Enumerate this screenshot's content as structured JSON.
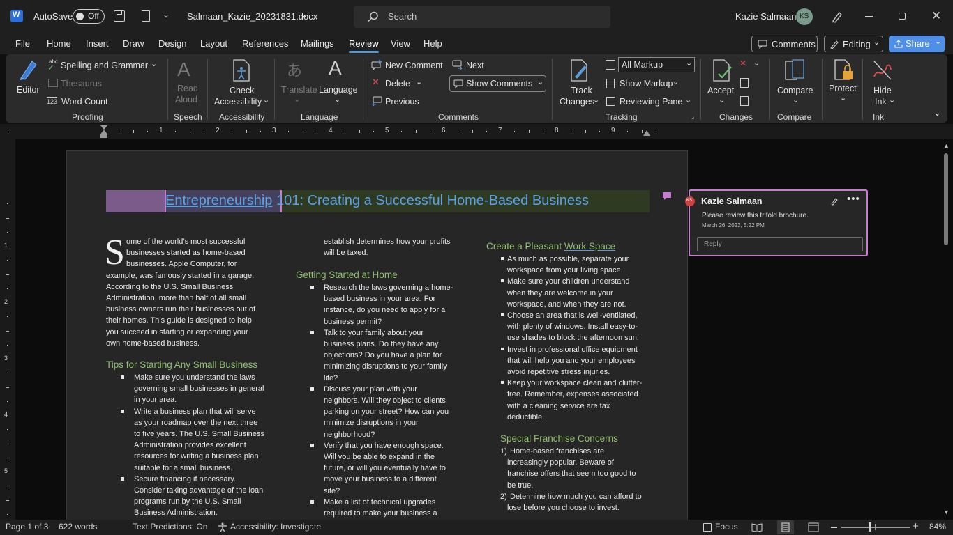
{
  "titlebar": {
    "autosave_label": "AutoSave",
    "autosave_state": "Off",
    "filename": "Salmaan_Kazie_20231831.docx",
    "search_placeholder": "Search",
    "user_name": "Kazie Salmaan",
    "user_initials": "KS"
  },
  "tabs": [
    "File",
    "Home",
    "Insert",
    "Draw",
    "Design",
    "Layout",
    "References",
    "Mailings",
    "Review",
    "View",
    "Help"
  ],
  "active_tab": "Review",
  "tab_actions": {
    "comments": "Comments",
    "editing": "Editing",
    "share": "Share"
  },
  "ribbon": {
    "proofing": {
      "editor": "Editor",
      "spelling": "Spelling and Grammar",
      "spelling_badge": "abc",
      "thesaurus": "Thesaurus",
      "word_count": "Word Count",
      "word_count_badge": "123",
      "group": "Proofing"
    },
    "speech": {
      "read": "Read",
      "aloud": "Aloud",
      "group": "Speech"
    },
    "accessibility": {
      "check": "Check",
      "label": "Accessibility",
      "group": "Accessibility"
    },
    "language": {
      "translate": "Translate",
      "language": "Language",
      "group": "Language"
    },
    "comments": {
      "new": "New Comment",
      "delete": "Delete",
      "previous": "Previous",
      "next": "Next",
      "show": "Show Comments",
      "group": "Comments"
    },
    "tracking": {
      "track": "Track",
      "changes": "Changes",
      "markup_select": "All Markup",
      "show_markup": "Show Markup",
      "reviewing_pane": "Reviewing Pane",
      "group": "Tracking"
    },
    "changes": {
      "accept": "Accept",
      "group": "Changes"
    },
    "compare": {
      "compare": "Compare",
      "group": "Compare"
    },
    "protect": {
      "protect": "Protect"
    },
    "ink": {
      "hide": "Hide",
      "ink": "Ink",
      "group": "Ink"
    }
  },
  "ruler": {
    "numbers": [
      "1",
      "2",
      "3",
      "4",
      "5",
      "6",
      "7",
      "8",
      "9"
    ],
    "vnumbers": [
      "1",
      "2",
      "3",
      "4",
      "5"
    ]
  },
  "document": {
    "title_highlight": "Entrepreneurship",
    "title_rest": " 101: Creating a Successful Home-Based Business",
    "col1": {
      "dropcap": "S",
      "intro_dropcap_lines": [
        "ome of the world’s most successful",
        "businesses started as home-based",
        "businesses. Apple Computer, for"
      ],
      "intro_lines": [
        "example, was famously started in a garage.",
        "According to the U.S. Small Business",
        "Administration, more than half of all small",
        "business owners run their businesses out of",
        "their homes. This guide is designed to help",
        "you succeed in starting or expanding your",
        "own home-based business."
      ],
      "heading": "Tips for Starting Any Small Business",
      "bullets": [
        [
          "Make sure you understand the laws",
          "governing small businesses in general",
          "in your area."
        ],
        [
          "Write a business plan that will serve",
          "as your roadmap over the next three",
          "to five years. The U.S. Small Business",
          "Administration provides excellent",
          "resources for writing a business plan",
          "suitable for a small business."
        ],
        [
          "Secure financing if necessary.",
          "Consider taking advantage of the loan",
          "programs run by the U.S. Small",
          "Business Administration."
        ]
      ]
    },
    "col2": {
      "cont_lines": [
        "establish determines how your profits",
        "will be taxed."
      ],
      "heading": "Getting Started at Home",
      "bullets": [
        [
          "Research the laws governing a home-",
          "based business in your area. For",
          "instance, do you need to apply for a",
          "business permit?"
        ],
        [
          "Talk to your family about your",
          "business plans. Do they have any",
          "objections? Do you have a plan for",
          "minimizing disruptions to your family",
          "life?"
        ],
        [
          "Discuss your plan with your",
          "neighbors. Will they object to clients",
          "parking on your street? How can you",
          "minimize disruptions in your",
          "neighborhood?"
        ],
        [
          "Verify that you have enough space.",
          "Will you be able to expand in the",
          "future, or will you eventually have to",
          "move your business to a different",
          "site?"
        ],
        [
          "Make a list of technical upgrades",
          "required to make your business a"
        ]
      ]
    },
    "col3": {
      "heading_a": "Create a Pleasant ",
      "heading_b": "Work Space",
      "bullets": [
        [
          "As much as possible, separate your",
          "workspace from your living space."
        ],
        [
          "Make sure your children understand",
          "when they are welcome in your",
          "workspace, and when they are not."
        ],
        [
          "Choose an area that is well-ventilated,",
          "with plenty of windows. Install easy-to-",
          "use shades to block the afternoon sun."
        ],
        [
          "Invest in professional office equipment",
          "that will help you and your employees",
          "avoid repetitive stress injuries."
        ],
        [
          "Keep your workspace clean and clutter-",
          "free. Remember, expenses associated",
          "with a cleaning service are tax",
          "deductible."
        ]
      ],
      "heading2": "Special Franchise Concerns",
      "numbered": [
        {
          "num": "1)",
          "lines": [
            "Home-based franchises are",
            "increasingly popular. Beware of",
            "franchise offers that seem too good to",
            "be true."
          ]
        },
        {
          "num": "2)",
          "lines": [
            "Determine how much you can afford to",
            "lose before you choose to invest."
          ]
        }
      ]
    }
  },
  "comment": {
    "author": "Kazie Salmaan",
    "initials": "KS",
    "text": "Please review this trifold brochure.",
    "date": "March 26, 2023, 5:22 PM",
    "reply_placeholder": "Reply"
  },
  "status": {
    "page": "Page 1 of 3",
    "words": "622 words",
    "predictions": "Text Predictions: On",
    "accessibility": "Accessibility: Investigate",
    "focus": "Focus",
    "zoom": "84%"
  },
  "colors": {
    "accent": "#5b9bd5",
    "heading_green": "#8fbf6f",
    "comment_border": "#c77dce",
    "share_btn": "#4f8fe8"
  }
}
